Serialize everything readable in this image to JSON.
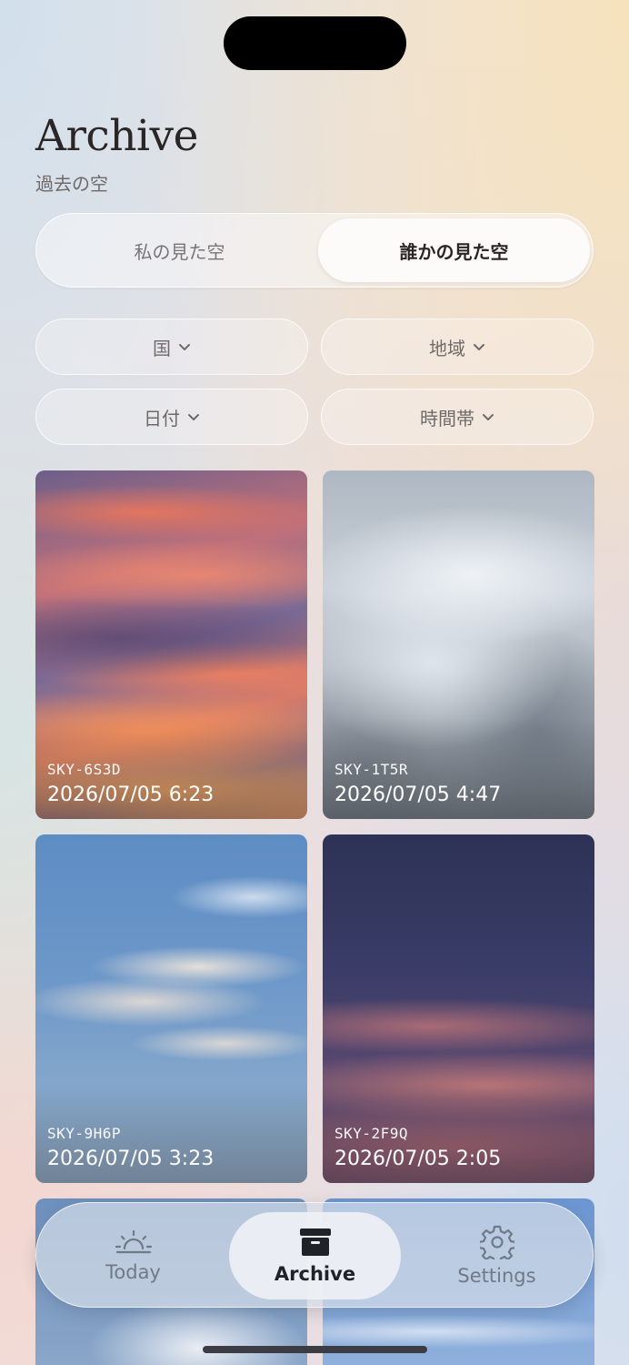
{
  "header": {
    "title": "Archive",
    "subtitle": "過去の空"
  },
  "segment": {
    "options": [
      "私の見た空",
      "誰かの見た空"
    ],
    "selected": "誰かの見た空"
  },
  "filters": {
    "country": "国",
    "region": "地域",
    "date": "日付",
    "time_of_day": "時間帯"
  },
  "photos": [
    {
      "code": "SKY-6S3D",
      "datetime": "2026/07/05 6:23"
    },
    {
      "code": "SKY-1T5R",
      "datetime": "2026/07/05 4:47"
    },
    {
      "code": "SKY-9H6P",
      "datetime": "2026/07/05 3:23"
    },
    {
      "code": "SKY-2F9Q",
      "datetime": "2026/07/05 2:05"
    }
  ],
  "tabbar": {
    "items": [
      {
        "label": "Today",
        "icon": "sunrise-icon"
      },
      {
        "label": "Archive",
        "icon": "archive-box-icon"
      },
      {
        "label": "Settings",
        "icon": "gear-icon"
      }
    ],
    "active": "Archive"
  },
  "colors": {
    "text_primary": "#2a2626",
    "text_secondary": "#6f6a6a",
    "tab_active": "#1f2328",
    "tab_inactive": "#707a86"
  }
}
